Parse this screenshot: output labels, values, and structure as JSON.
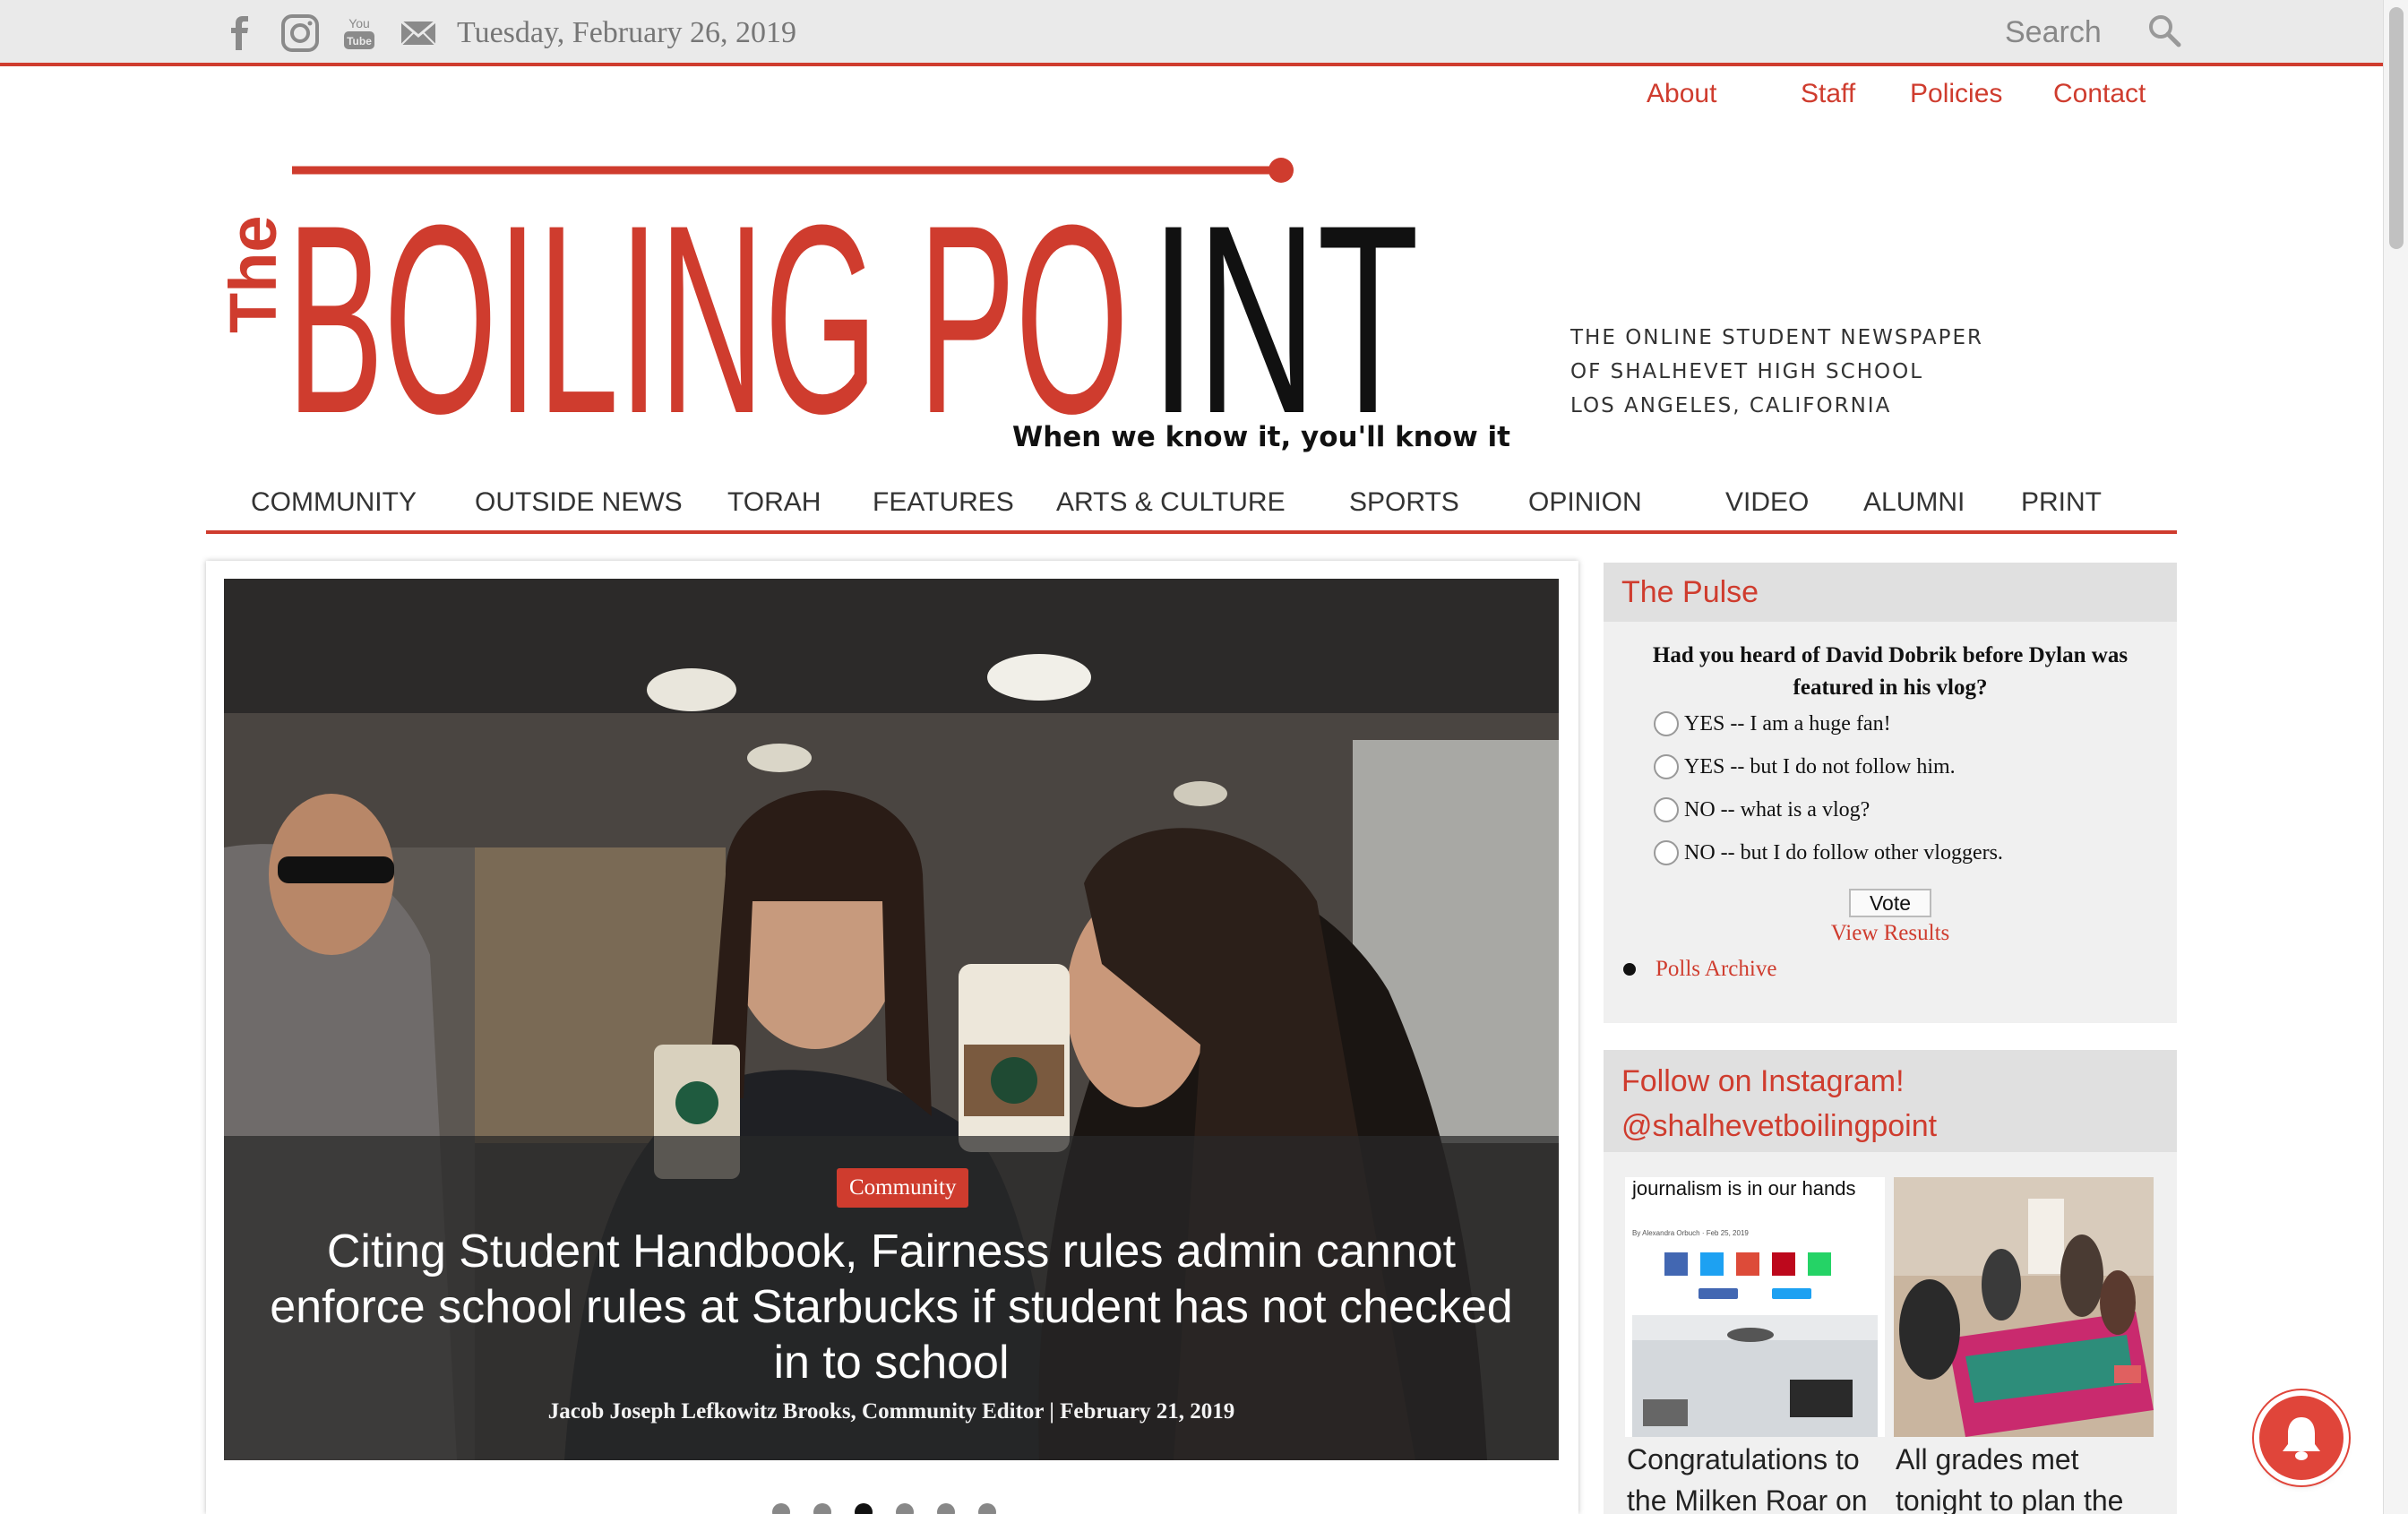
{
  "topbar": {
    "social_icons": [
      "facebook-icon",
      "instagram-icon",
      "youtube-icon",
      "email-icon"
    ],
    "date": "Tuesday, February 26, 2019",
    "search_placeholder": "Search"
  },
  "subnav": {
    "items": [
      "About",
      "Staff",
      "Policies",
      "Contact"
    ]
  },
  "masthead": {
    "the": "The",
    "name_red": "BOILING PO",
    "name_black": "INT",
    "motto": "When we know it, you'll know it",
    "tagline": [
      "THE ONLINE STUDENT NEWSPAPER",
      "OF SHALHEVET HIGH SCHOOL",
      "LOS ANGELES, CALIFORNIA"
    ]
  },
  "mainnav": {
    "items": [
      "COMMUNITY",
      "OUTSIDE NEWS",
      "TORAH",
      "FEATURES",
      "ARTS & CULTURE",
      "SPORTS",
      "OPINION",
      "VIDEO",
      "ALUMNI",
      "PRINT"
    ]
  },
  "hero": {
    "category": "Community",
    "title": "Citing Student Handbook, Fairness rules admin cannot enforce school rules at Starbucks if student has not checked in to school",
    "byline": "Jacob Joseph Lefkowitz Brooks, Community Editor  |  February 21, 2019",
    "slides": 6,
    "active_slide": 3
  },
  "poll": {
    "title": "The Pulse",
    "question": "Had you heard of David Dobrik before Dylan was featured in his vlog?",
    "options": [
      "YES -- I am a huge fan!",
      "YES -- but I do not follow him.",
      "NO -- what is a vlog?",
      "NO -- but I do follow other vloggers."
    ],
    "vote_label": "Vote",
    "results_label": "View Results",
    "archive_label": "Polls Archive"
  },
  "instagram": {
    "title_line1": "Follow on Instagram!",
    "title_line2": "@shalhevetboilingpoint",
    "post1_headline": "journalism is in our hands",
    "post1_author": "By Alexandra Orbuch  ·  Feb 25, 2019",
    "captions": [
      "Congratulations to the Milken Roar on",
      "All grades met tonight to plan the"
    ]
  },
  "colors": {
    "accent": "#cf3c2e",
    "topbar_bg": "#eaeaea",
    "widget_bg": "#f0f0f0"
  }
}
